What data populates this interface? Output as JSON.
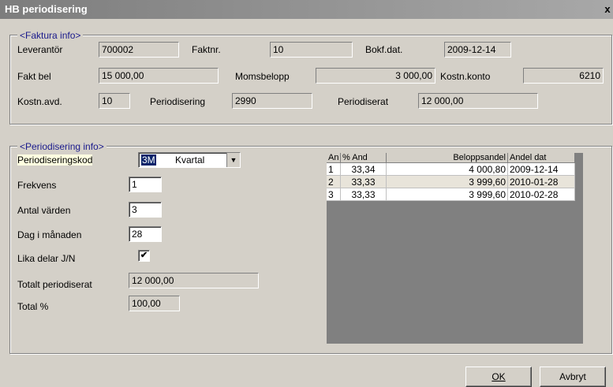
{
  "window": {
    "title": "HB periodisering",
    "close": "x"
  },
  "faktura": {
    "legend": "<Faktura info>",
    "leverantor_label": "Leverantör",
    "leverantor": "700002",
    "faktnr_label": "Faktnr.",
    "faktnr": "10",
    "bokfdat_label": "Bokf.dat.",
    "bokfdat": "2009-12-14",
    "faktbel_label": "Fakt bel",
    "faktbel": "15 000,00",
    "moms_label": "Momsbelopp",
    "moms": "3 000,00",
    "kostnkonto_label": "Kostn.konto",
    "kostnkonto": "6210",
    "kostnavd_label": "Kostn.avd.",
    "kostnavd": "10",
    "period_label": "Periodisering",
    "period": "2990",
    "periodiserat_label": "Periodiserat",
    "periodiserat": "12 000,00"
  },
  "periodisering": {
    "legend": "<Periodisering info>",
    "kod_label": "Periodiseringskod",
    "kod": "3M",
    "kod_text": "Kvartal",
    "frekvens_label": "Frekvens",
    "frekvens": "1",
    "antal_label": "Antal värden",
    "antal": "3",
    "dag_label": "Dag i månaden",
    "dag": "28",
    "lika_label": "Lika delar J/N",
    "lika_checked": true,
    "totalt_label": "Totalt periodiserat",
    "totalt": "12 000,00",
    "totalpct_label": "Total %",
    "totalpct": "100,00"
  },
  "grid": {
    "headers": [
      "An",
      "% And",
      "Beloppsandel",
      "Andel dat"
    ],
    "rows": [
      [
        "1",
        "33,34",
        "4 000,80",
        "2009-12-14"
      ],
      [
        "2",
        "33,33",
        "3 999,60",
        "2010-01-28"
      ],
      [
        "3",
        "33,33",
        "3 999,60",
        "2010-02-28"
      ]
    ]
  },
  "buttons": {
    "ok": "OK",
    "avbryt": "Avbryt"
  }
}
